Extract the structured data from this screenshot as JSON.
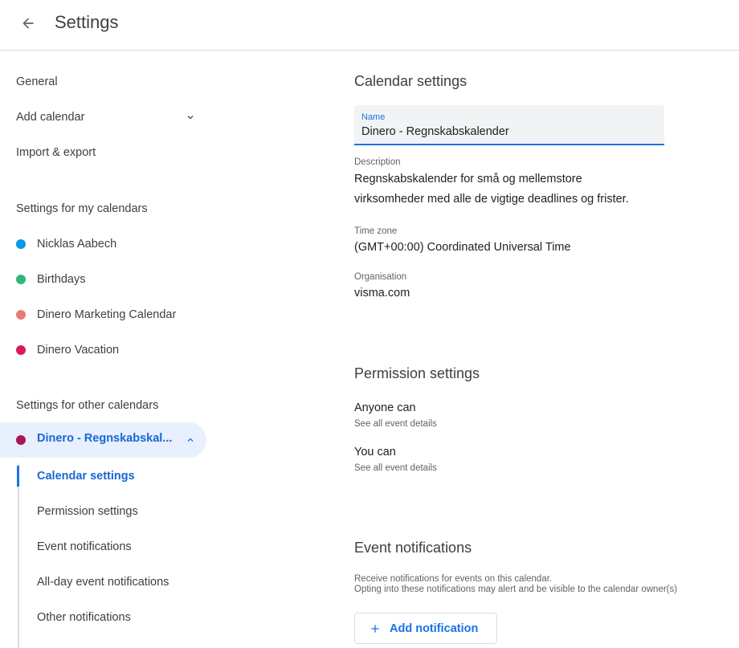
{
  "header": {
    "title": "Settings",
    "back_icon": "arrow-back-icon"
  },
  "sidebar": {
    "general": "General",
    "add_calendar": "Add calendar",
    "import_export": "Import & export",
    "my_calendars_heading": "Settings for my calendars",
    "my_calendars": [
      {
        "label": "Nicklas Aabech",
        "color": "#039be5"
      },
      {
        "label": "Birthdays",
        "color": "#33b679"
      },
      {
        "label": "Dinero Marketing Calendar",
        "color": "#e67c73"
      },
      {
        "label": "Dinero Vacation",
        "color": "#d81b60"
      }
    ],
    "other_calendars_heading": "Settings for other calendars",
    "active_calendar": {
      "label": "Dinero - Regnskabskal...",
      "color": "#ad1457"
    },
    "sub_items": [
      "Calendar settings",
      "Permission settings",
      "Event notifications",
      "All-day event notifications",
      "Other notifications"
    ]
  },
  "main": {
    "calendar_settings_title": "Calendar settings",
    "name_label": "Name",
    "name_value": "Dinero - Regnskabskalender",
    "description_label": "Description",
    "description_line1": "Regnskabskalender for små og mellemstore",
    "description_line2": "virksomheder med alle de vigtige deadlines og frister.",
    "timezone_label": "Time zone",
    "timezone_value": "(GMT+00:00) Coordinated Universal Time",
    "organisation_label": "Organisation",
    "organisation_value": "visma.com",
    "permission_title": "Permission settings",
    "anyone_can": "Anyone can",
    "anyone_detail": "See all event details",
    "you_can": "You can",
    "you_detail": "See all event details",
    "event_notifications_title": "Event notifications",
    "notif_desc_line1": "Receive notifications for events on this calendar.",
    "notif_desc_line2": "Opting into these notifications may alert and be visible to the calendar owner(s)",
    "add_notification": "Add notification"
  },
  "colors": {
    "accent": "#1a73e8",
    "active_bg": "#e8f0fe"
  }
}
